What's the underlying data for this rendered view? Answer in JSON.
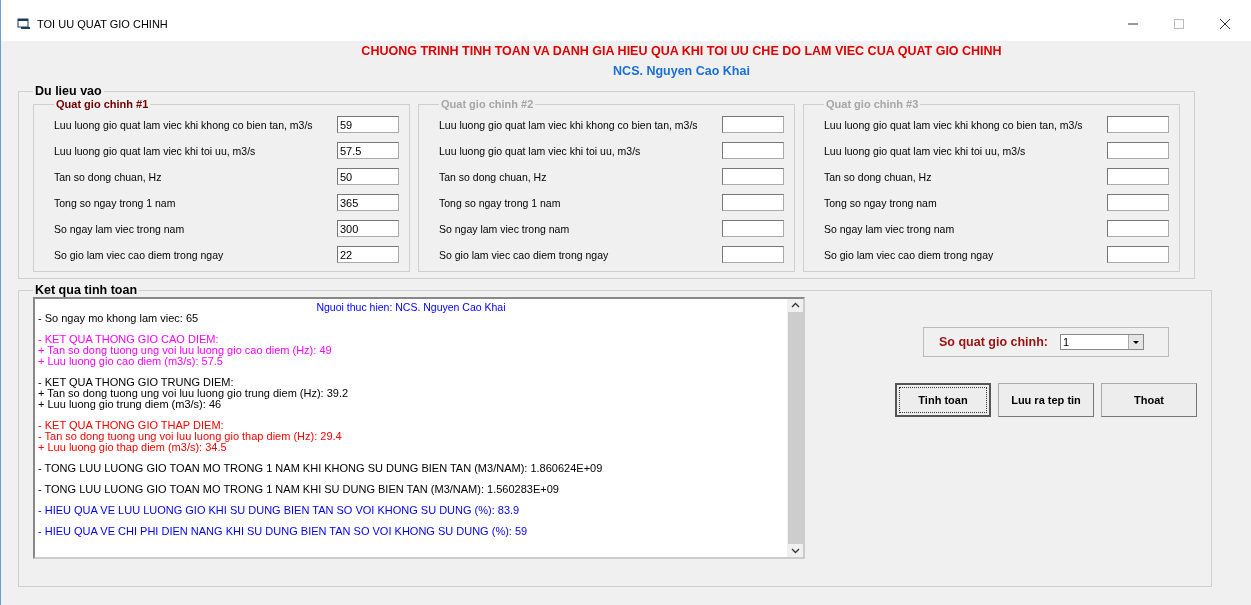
{
  "window": {
    "title": "TOI UU QUAT GIO CHINH"
  },
  "header": {
    "title": "CHUONG TRINH TINH TOAN VA DANH GIA HIEU QUA KHI TOI UU CHE DO LAM VIEC CUA QUAT GIO CHINH",
    "author": "NCS. Nguyen Cao Khai"
  },
  "input": {
    "title": "Du lieu vao",
    "groups": [
      {
        "title": "Quat gio chinh #1",
        "disabled": false,
        "fields": [
          {
            "label": "Luu luong gio quat lam viec khi khong co bien tan, m3/s",
            "value": "59"
          },
          {
            "label": "Luu luong gio quat lam viec khi toi uu, m3/s",
            "value": "57.5"
          },
          {
            "label": "Tan so dong chuan, Hz",
            "value": "50"
          },
          {
            "label": "Tong so ngay trong 1 nam",
            "value": "365"
          },
          {
            "label": "So ngay lam viec trong nam",
            "value": "300"
          },
          {
            "label": "So gio lam viec cao diem trong ngay",
            "value": "22"
          }
        ]
      },
      {
        "title": "Quat gio chinh #2",
        "disabled": true,
        "fields": [
          {
            "label": "Luu luong gio quat lam viec khi khong co bien tan, m3/s"
          },
          {
            "label": "Luu luong gio quat lam viec khi toi uu, m3/s"
          },
          {
            "label": "Tan so dong chuan, Hz"
          },
          {
            "label": "Tong so ngay trong 1 nam"
          },
          {
            "label": "So ngay lam viec trong nam"
          },
          {
            "label": "So gio lam viec cao diem trong ngay"
          }
        ]
      },
      {
        "title": "Quat gio chinh #3",
        "disabled": true,
        "fields": [
          {
            "label": "Luu luong gio quat lam viec khi khong co bien tan, m3/s"
          },
          {
            "label": "Luu luong gio quat lam viec khi toi uu, m3/s"
          },
          {
            "label": "Tan so dong chuan, Hz"
          },
          {
            "label": "Tong so ngay trong nam"
          },
          {
            "label": "So ngay lam viec trong nam"
          },
          {
            "label": "So gio lam viec cao diem trong ngay"
          }
        ]
      }
    ]
  },
  "results": {
    "title": "Ket qua tinh toan",
    "author_line": "Nguoi thuc hien: NCS. Nguyen Cao Khai",
    "blocks": [
      {
        "color": "#000000",
        "lines": [
          "- So ngay mo khong lam viec: 65"
        ]
      },
      {
        "color": "#ff00ff",
        "lines": [
          "- KET QUA THONG GIO CAO DIEM:",
          "+ Tan so dong tuong ung voi luu luong gio cao diem (Hz): 49",
          "+ Luu luong gio cao diem (m3/s): 57.5"
        ]
      },
      {
        "color": "#000000",
        "lines": [
          "- KET QUA THONG GIO TRUNG DIEM:",
          "+ Tan so dong tuong ung voi luu luong gio trung diem (Hz): 39.2",
          "+ Luu luong gio trung diem (m3/s): 46"
        ]
      },
      {
        "color": "#ff0000",
        "lines": [
          "- KET QUA THONG GIO THAP DIEM:",
          "- Tan so dong tuong ung voi luu luong gio thap diem (Hz): 29.4",
          "+ Luu luong gio thap diem (m3/s): 34.5"
        ]
      },
      {
        "color": "#000000",
        "lines": [
          "- TONG LUU LUONG GIO TOAN MO TRONG 1 NAM KHI KHONG SU DUNG BIEN TAN (M3/NAM): 1.860624E+09"
        ]
      },
      {
        "color": "#000000",
        "lines": [
          "- TONG LUU LUONG GIO TOAN MO TRONG 1 NAM KHI SU DUNG BIEN TAN (M3/NAM): 1.560283E+09"
        ]
      },
      {
        "color": "#0000ff",
        "lines": [
          "- HIEU QUA VE LUU LUONG GIO KHI SU DUNG BIEN TAN SO VOI KHONG SU DUNG (%): 83.9"
        ]
      },
      {
        "color": "#0000ff",
        "lines": [
          "- HIEU QUA VE CHI PHI DIEN NANG KHI SU DUNG BIEN TAN SO VOI KHONG SU DUNG (%): 59"
        ]
      }
    ]
  },
  "fan_count": {
    "label": "So quat gio chinh:",
    "value": "1"
  },
  "buttons": [
    {
      "label": "Tinh toan",
      "selected": true
    },
    {
      "label": "Luu ra tep tin",
      "selected": false
    },
    {
      "label": "Thoat",
      "selected": false
    }
  ]
}
